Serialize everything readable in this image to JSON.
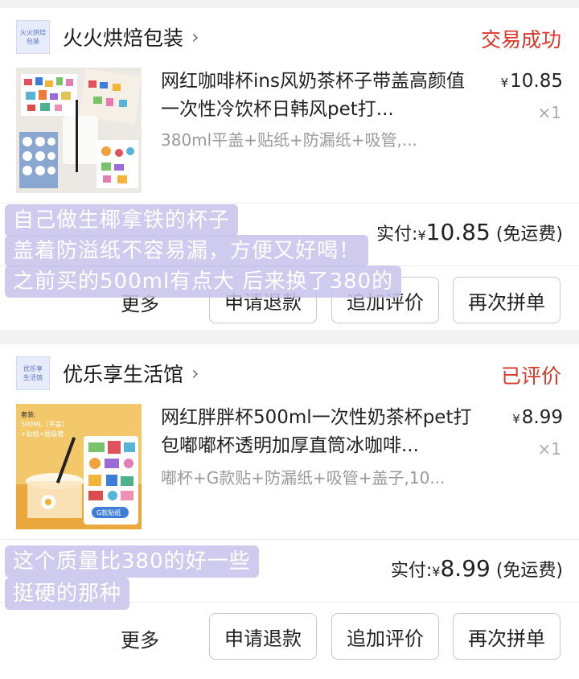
{
  "orders": [
    {
      "shop": {
        "logo_text": "火火烘焙\n包装",
        "name": "火火烘焙包装",
        "arrow": "›"
      },
      "status": "交易成功",
      "status_color": "#d9372b",
      "item": {
        "title": "网红咖啡杯ins风奶茶杯子带盖高颜值一次性冷饮杯日韩风pet打...",
        "sku": "380ml平盖+贴纸+防漏纸+吸管,...",
        "price_symbol": "¥",
        "price": "10.85",
        "qty": "×1"
      },
      "paid": {
        "label": "实付:",
        "symbol": "¥",
        "amount": "10.85",
        "suffix": "(免运费)"
      },
      "actions": {
        "more": "更多",
        "refund": "申请退款",
        "review": "追加评价",
        "reorder": "再次拼单"
      }
    },
    {
      "shop": {
        "logo_text": "优乐享\n生活馆",
        "name": "优乐享生活馆",
        "arrow": "›"
      },
      "status": "已评价",
      "status_color": "#d9372b",
      "item": {
        "title": "网红胖胖杯500ml一次性奶茶杯pet打包嘟嘟杯透明加厚直筒冰咖啡...",
        "sku": "嘟杯+G款贴+防漏纸+吸管+盖子,10...",
        "price_symbol": "¥",
        "price": "8.99",
        "qty": "×1",
        "thumb_text": {
          "l1": "套装:",
          "l2": "500ML（平盖）",
          "l3": "+贴纸+插吸管",
          "badge": "G款贴纸"
        }
      },
      "paid": {
        "label": "实付:",
        "symbol": "¥",
        "amount": "8.99",
        "suffix": "(免运费)"
      },
      "actions": {
        "more": "更多",
        "refund": "申请退款",
        "review": "追加评价",
        "reorder": "再次拼单"
      }
    }
  ],
  "notes": {
    "n1": "自己做生椰拿铁的杯子",
    "n2": "盖着防溢纸不容易漏，方便又好喝！",
    "n3": "之前买的500ml有点大 后来换了380的",
    "n4": "这个质量比380的好一些",
    "n5": "挺硬的那种"
  }
}
